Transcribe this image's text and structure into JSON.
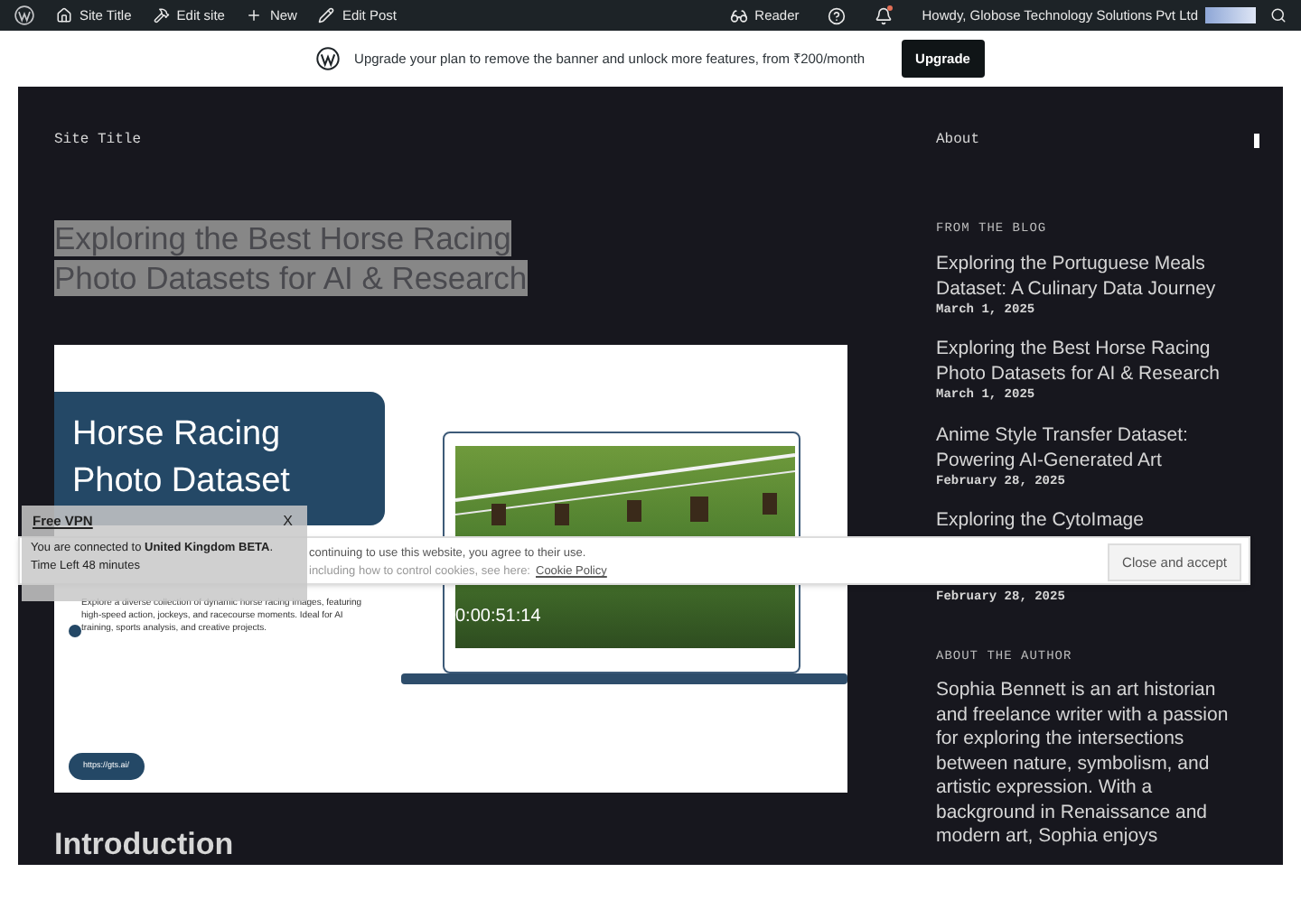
{
  "admin_bar": {
    "left_items": [
      {
        "kind": "home",
        "label": "Site Title"
      },
      {
        "kind": "hammer",
        "label": "Edit site"
      },
      {
        "kind": "plus",
        "label": "New"
      },
      {
        "kind": "pencil",
        "label": "Edit Post"
      }
    ],
    "reader": "Reader",
    "notifications": {
      "unread": true
    },
    "greeting": "Howdy, Globose Technology Solutions Pvt Ltd"
  },
  "upgrade_banner": {
    "text": "Upgrade your plan to remove the banner and unlock more features, from ₹200/month",
    "button": "Upgrade"
  },
  "header": {
    "site_title": "Site Title",
    "nav_item": "About"
  },
  "post": {
    "title": "Exploring the Best Horse Racing Photo Datasets for AI & Research",
    "highlighted": true,
    "featured_image": {
      "heading": "Horse Racing Photo Dataset",
      "timestamp": "0:00:51:14",
      "description": "Explore a diverse collection of dynamic horse racing images, featuring high-speed action, jockeys, and racecourse moments. Ideal for AI training, sports analysis, and creative projects.",
      "url": "https://gts.ai/"
    },
    "section_heading": "Introduction"
  },
  "sidebar": {
    "blog_heading": "FROM THE BLOG",
    "posts": [
      {
        "title": "Exploring the Portuguese Meals Dataset: A Culinary Data Journey",
        "date": "March 1, 2025"
      },
      {
        "title": "Exploring the Best Horse Racing Photo Datasets for AI & Research",
        "date": "March 1, 2025"
      },
      {
        "title": "Anime Style Transfer Dataset: Powering AI-Generated Art",
        "date": "February 28, 2025"
      },
      {
        "title": "Exploring the CytoImage",
        "date": "February 28, 2025"
      }
    ],
    "author_heading": "ABOUT THE AUTHOR",
    "author_bio": "Sophia Bennett is an art historian and freelance writer with a passion for exploring the intersections between nature, symbolism, and artistic expression. With a background in Renaissance and modern art, Sophia enjoys"
  },
  "cookie_banner": {
    "line_1": "continuing to use this website, you agree to their use.",
    "line_2": "including how to control cookies, see here:",
    "link": "Cookie Policy",
    "button": "Close and accept"
  },
  "vpn_popup": {
    "title": "Free VPN",
    "close": "X",
    "message": "You are connected to **United Kingdom BETA**.",
    "time_left": "Time Left 48 minutes"
  }
}
